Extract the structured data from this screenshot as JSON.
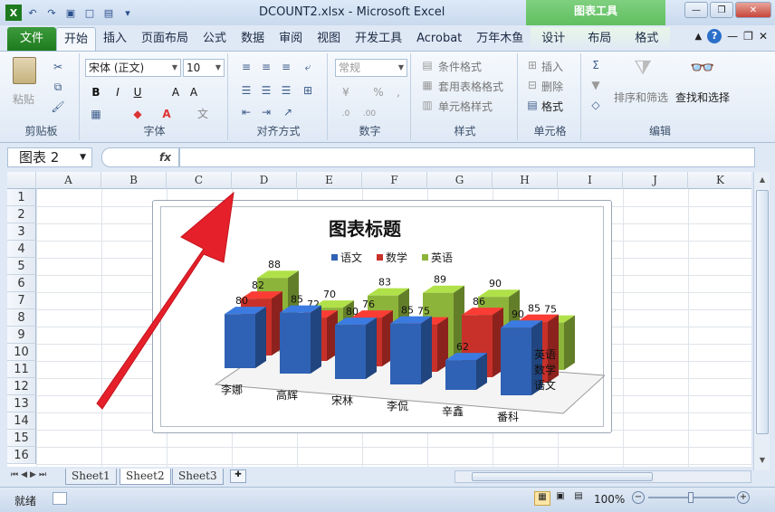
{
  "window": {
    "title": "DCOUNT2.xlsx - Microsoft Excel",
    "context_group": "图表工具"
  },
  "tabs": [
    "文件",
    "开始",
    "插入",
    "页面布局",
    "公式",
    "数据",
    "审阅",
    "视图",
    "开发工具",
    "Acrobat",
    "万年木鱼",
    "设计",
    "布局",
    "格式"
  ],
  "ribbon": {
    "clipboard": {
      "paste": "粘贴",
      "label": "剪贴板"
    },
    "font": {
      "name": "宋体 (正文)",
      "size": "10",
      "label": "字体"
    },
    "alignment": {
      "label": "对齐方式"
    },
    "number": {
      "format": "常规",
      "label": "数字"
    },
    "styles": {
      "cond": "条件格式",
      "table": "套用表格格式",
      "cell": "单元格样式",
      "label": "样式"
    },
    "cells": {
      "insert": "插入",
      "delete": "删除",
      "format": "格式",
      "label": "单元格"
    },
    "editing": {
      "sort": "排序和筛选",
      "find": "查找和选择",
      "label": "编辑"
    }
  },
  "formula_bar": {
    "name_box": "图表 2",
    "fx": "fx"
  },
  "columns": [
    "A",
    "B",
    "C",
    "D",
    "E",
    "F",
    "G",
    "H",
    "I",
    "J",
    "K"
  ],
  "rows": [
    "1",
    "2",
    "3",
    "4",
    "5",
    "6",
    "7",
    "8",
    "9",
    "10",
    "11",
    "12",
    "13",
    "14",
    "15",
    "16"
  ],
  "sheets": [
    "Sheet1",
    "Sheet2",
    "Sheet3"
  ],
  "status": {
    "ready": "就绪",
    "zoom": "100%"
  },
  "chart_data": {
    "type": "bar",
    "title": "图表标题",
    "categories": [
      "李娜",
      "高辉",
      "宋林",
      "李侃",
      "辛鑫",
      "番科"
    ],
    "series": [
      {
        "name": "语文",
        "values": [
          80,
          85,
          80,
          85,
          62,
          90
        ]
      },
      {
        "name": "数学",
        "values": [
          82,
          72,
          76,
          75,
          86,
          85
        ]
      },
      {
        "name": "英语",
        "values": [
          88,
          70,
          83,
          89,
          90,
          75
        ]
      }
    ],
    "depth_labels": [
      "英语",
      "数学",
      "语文"
    ],
    "legend": "top",
    "colors": {
      "语文": "#2f62b4",
      "数学": "#c8302a",
      "英语": "#8db43a"
    }
  }
}
